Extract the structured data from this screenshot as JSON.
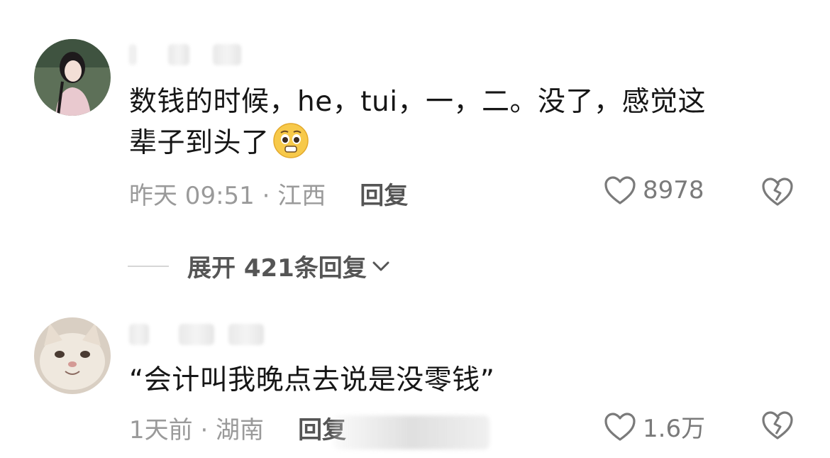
{
  "comments": [
    {
      "text_line1": "数钱的时候，he，tui，一，二。没了，感觉这",
      "text_line2": "辈子到头了",
      "emoji": "pleading-face-emoji",
      "time_location": "昨天 09:51 · 江西",
      "reply_label": "回复",
      "like_count": "8978"
    },
    {
      "text": "“会计叫我晚点去说是没零钱”",
      "time_location": "1天前 · 湖南",
      "reply_label": "回复",
      "like_count": "1.6万"
    }
  ],
  "expand_replies": {
    "label": "展开 421条回复",
    "icon": "chevron-down-icon"
  },
  "colors": {
    "text": "#161616",
    "meta": "#9a9a9a",
    "action": "#555555",
    "icon": "#7a7a7a"
  }
}
